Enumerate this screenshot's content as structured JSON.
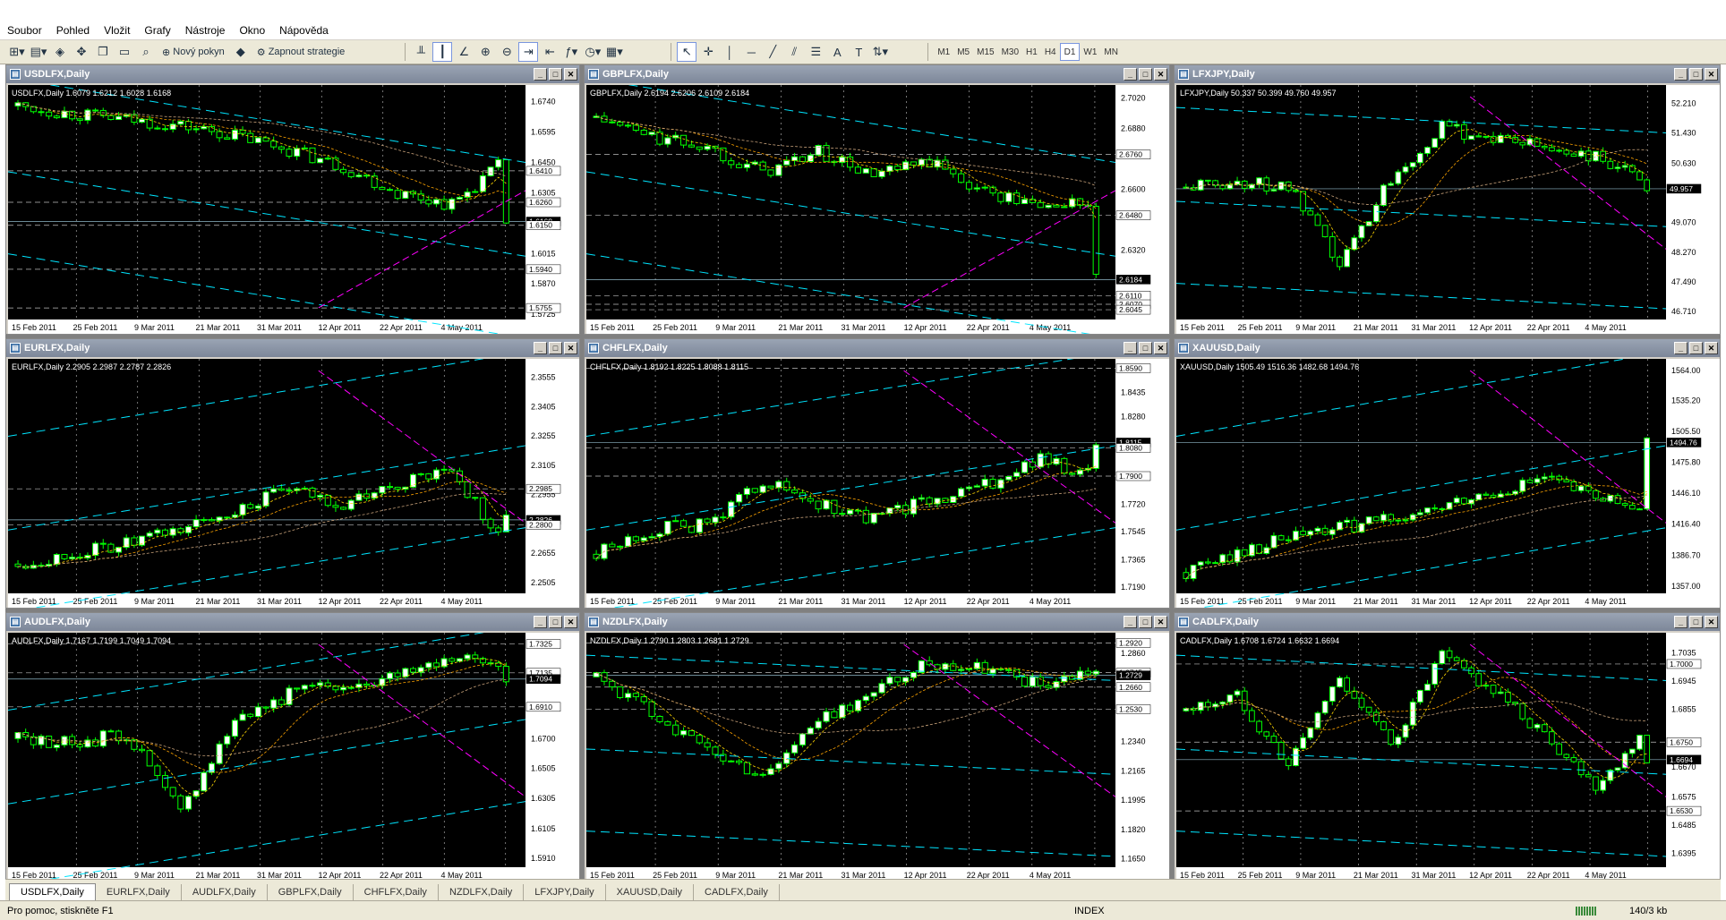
{
  "menu": [
    "Soubor",
    "Pohled",
    "Vložit",
    "Grafy",
    "Nástroje",
    "Okno",
    "Nápověda"
  ],
  "toolbar": {
    "new_order": "Nový pokyn",
    "strategy": "Zapnout strategie",
    "text_tool": "A",
    "timeframes": [
      "M1",
      "M5",
      "M15",
      "M30",
      "H1",
      "H4",
      "D1",
      "W1",
      "MN"
    ],
    "active_timeframe": "D1"
  },
  "dates": [
    "15 Feb 2011",
    "25 Feb 2011",
    "9 Mar 2011",
    "21 Mar 2011",
    "31 Mar 2011",
    "12 Apr 2011",
    "22 Apr 2011",
    "4 May 2011"
  ],
  "charts": [
    {
      "title": "USDLFX,Daily",
      "info": "USDLFX,Daily  1.6079 1.6212 1.6028 1.6168",
      "ticks": [
        "1.6740",
        "1.6595",
        "1.6450",
        "1.6305",
        "1.6015",
        "1.5870",
        "1.5725"
      ],
      "marks": [
        "1.6410",
        "1.6260",
        "1.6168",
        "1.6150",
        "1.5940",
        "1.5755"
      ],
      "min": 1.57,
      "max": 1.682,
      "start": 1.672,
      "end": 1.6168,
      "shape": [
        0,
        -0.08,
        -0.14,
        -0.2,
        -0.3,
        -0.44,
        -0.62,
        -0.88,
        -1.0,
        -0.55
      ],
      "trend": "down"
    },
    {
      "title": "GBPLFX,Daily",
      "info": "GBPLFX,Daily  2.6194 2.6206 2.6109 2.6184",
      "ticks": [
        "2.7020",
        "2.6880",
        "2.6600",
        "2.6320",
        "2.6040"
      ],
      "marks": [
        "2.6760",
        "2.6480",
        "2.6184",
        "2.6110",
        "2.6070",
        "2.6045"
      ],
      "min": 2.6,
      "max": 2.708,
      "start": 2.693,
      "end": 2.6184,
      "shape": [
        0,
        -0.2,
        -0.3,
        -0.55,
        -0.35,
        -0.6,
        -0.45,
        -0.75,
        -0.9,
        -0.85
      ],
      "trend": "down"
    },
    {
      "title": "LFXJPY,Daily",
      "info": "LFXJPY,Daily  50.337 50.399 49.760 49.957",
      "ticks": [
        "52.210",
        "51.430",
        "50.630",
        "49.070",
        "48.270",
        "47.490",
        "46.710"
      ],
      "marks": [
        "49.957"
      ],
      "min": 46.5,
      "max": 52.7,
      "start": 50.0,
      "end": 49.957,
      "shape": [
        0,
        0.05,
        0,
        -0.8,
        0.1,
        0.6,
        0.5,
        0.4,
        0.3,
        0.05
      ],
      "trend": "flat"
    },
    {
      "title": "EURLFX,Daily",
      "info": "EURLFX,Daily  2.2905 2.2987 2.2787 2.2826",
      "ticks": [
        "2.3555",
        "2.3405",
        "2.3255",
        "2.3105",
        "2.2955",
        "2.2655",
        "2.2505"
      ],
      "marks": [
        "2.2985",
        "2.2826",
        "2.2800"
      ],
      "min": 2.245,
      "max": 2.365,
      "start": 2.26,
      "end": 2.2826,
      "shape": [
        0,
        0.1,
        0.2,
        0.35,
        0.55,
        0.75,
        0.6,
        0.8,
        0.95,
        0.2
      ],
      "trend": "up"
    },
    {
      "title": "CHFLFX,Daily",
      "info": "CHFLFX,Daily  1.8192 1.8225 1.8088 1.8115",
      "ticks": [
        "1.8435",
        "1.8280",
        "1.7720",
        "1.7545",
        "1.7365",
        "1.7190"
      ],
      "marks": [
        "1.8590",
        "1.8115",
        "1.8080",
        "1.7900"
      ],
      "min": 1.715,
      "max": 1.865,
      "start": 1.74,
      "end": 1.8115,
      "shape": [
        0,
        0.25,
        0.3,
        0.75,
        0.5,
        0.35,
        0.55,
        0.7,
        0.95,
        0.8
      ],
      "trend": "up"
    },
    {
      "title": "XAUUSD,Daily",
      "info": "XAUUSD,Daily  1505.49 1516.36 1482.68 1494.76",
      "ticks": [
        "1564.00",
        "1535.20",
        "1505.50",
        "1475.80",
        "1446.10",
        "1416.40",
        "1386.70",
        "1357.00"
      ],
      "marks": [
        "1494.76"
      ],
      "min": 1350.0,
      "max": 1575.0,
      "start": 1370.0,
      "end": 1494.76,
      "shape": [
        0,
        0.2,
        0.35,
        0.45,
        0.55,
        0.65,
        0.8,
        0.95,
        0.75,
        0.7
      ],
      "trend": "up"
    },
    {
      "title": "AUDLFX,Daily",
      "info": "AUDLFX,Daily  1.7167 1.7199 1.7049 1.7094",
      "ticks": [
        "1.6700",
        "1.6505",
        "1.6305",
        "1.6105",
        "1.5910"
      ],
      "marks": [
        "1.7325",
        "1.7135",
        "1.7094",
        "1.6910"
      ],
      "min": 1.585,
      "max": 1.74,
      "start": 1.67,
      "end": 1.7094,
      "shape": [
        0,
        -0.05,
        0.05,
        -0.75,
        0.2,
        0.45,
        0.55,
        0.65,
        0.85,
        0.75
      ],
      "trend": "up"
    },
    {
      "title": "NZDLFX,Daily",
      "info": "NZDLFX,Daily  1.2790 1.2803 1.2681 1.2729",
      "ticks": [
        "1.2860",
        "1.2340",
        "1.2165",
        "1.1995",
        "1.1820",
        "1.1650"
      ],
      "marks": [
        "1.2920",
        "1.2745",
        "1.2729",
        "1.2660",
        "1.2530"
      ],
      "min": 1.16,
      "max": 1.298,
      "start": 1.272,
      "end": 1.2729,
      "shape": [
        0,
        -0.35,
        -0.75,
        -1.0,
        -0.45,
        -0.15,
        0.15,
        0.1,
        -0.1,
        0.05
      ],
      "trend": "flat"
    },
    {
      "title": "CADLFX,Daily",
      "info": "CADLFX,Daily  1.6708 1.6724 1.6632 1.6694",
      "ticks": [
        "1.7035",
        "1.6945",
        "1.6855",
        "1.6670",
        "1.6575",
        "1.6485",
        "1.6395"
      ],
      "marks": [
        "1.7000",
        "1.6750",
        "1.6694",
        "1.6530"
      ],
      "min": 1.635,
      "max": 1.71,
      "start": 1.685,
      "end": 1.6694,
      "shape": [
        0,
        0.15,
        -0.55,
        0.35,
        -0.35,
        0.55,
        0.2,
        -0.25,
        -0.75,
        -0.2
      ],
      "trend": "flat"
    }
  ],
  "tabs": [
    "USDLFX,Daily",
    "EURLFX,Daily",
    "AUDLFX,Daily",
    "GBPLFX,Daily",
    "CHFLFX,Daily",
    "NZDLFX,Daily",
    "LFXJPY,Daily",
    "XAUUSD,Daily",
    "CADLFX,Daily"
  ],
  "active_tab": "USDLFX,Daily",
  "status": {
    "help": "Pro pomoc, stiskněte F1",
    "profile": "INDEX",
    "traffic": "140/3 kb"
  },
  "colors": {
    "chart_bg": "#000000",
    "candle": "#00ff00",
    "grid": "#c0c0c0",
    "channel": "#00e5ff",
    "magenta": "#ff00ff",
    "ma_orange": "#ffa500",
    "ma_yellow": "#ffd700"
  }
}
